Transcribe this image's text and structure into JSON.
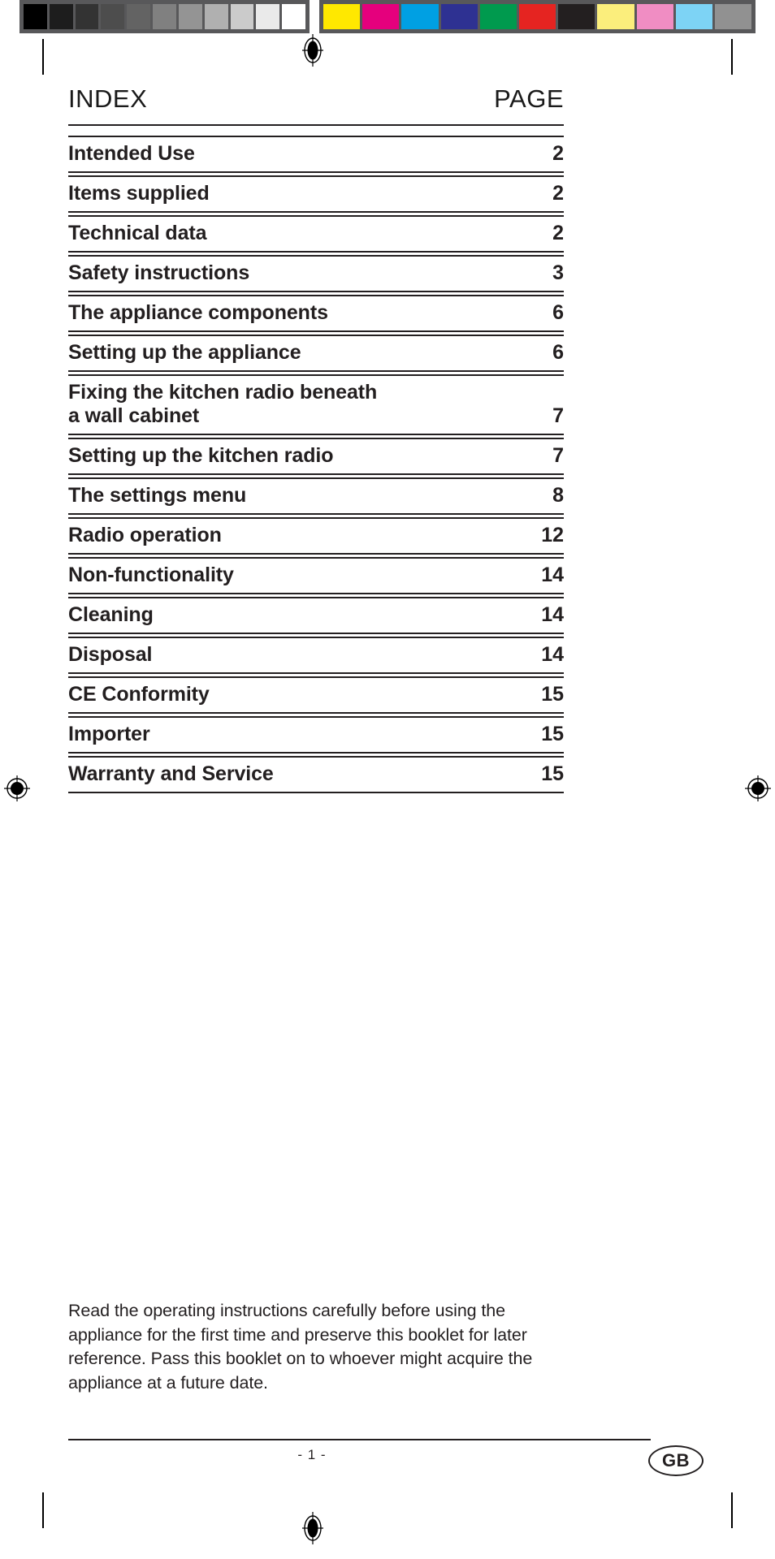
{
  "document": {
    "page_number_footer": "- 1 -",
    "language_badge": "GB"
  },
  "calibration": {
    "gray_bar": {
      "name": "grayscale-calibration-bar",
      "swatches": [
        "#000000",
        "#1d1d1d",
        "#333333",
        "#4d4d4d",
        "#636363",
        "#808080",
        "#949494",
        "#b0b0b0",
        "#cbcbcb",
        "#eaeaea",
        "#ffffff"
      ]
    },
    "color_bar": {
      "name": "color-calibration-bar",
      "swatches": [
        "#ffe800",
        "#e5007d",
        "#00a0e3",
        "#2e3192",
        "#009a4e",
        "#e52421",
        "#231f20",
        "#fbee7c",
        "#f08dc3",
        "#7dd3f5",
        "#919191"
      ]
    }
  },
  "toc": {
    "header": {
      "index_label": "INDEX",
      "page_label": "PAGE"
    },
    "entries": [
      {
        "title": "Intended Use",
        "page": "2"
      },
      {
        "title": "Items supplied",
        "page": "2"
      },
      {
        "title": "Technical data",
        "page": "2"
      },
      {
        "title": "Safety instructions",
        "page": "3"
      },
      {
        "title": "The appliance components",
        "page": "6"
      },
      {
        "title": "Setting up the appliance",
        "page": "6"
      },
      {
        "title": "Fixing the kitchen radio beneath\na wall cabinet",
        "page": "7"
      },
      {
        "title": "Setting up the kitchen radio",
        "page": "7"
      },
      {
        "title": "The settings menu",
        "page": "8"
      },
      {
        "title": "Radio operation",
        "page": "12"
      },
      {
        "title": "Non-functionality",
        "page": "14"
      },
      {
        "title": "Cleaning",
        "page": "14"
      },
      {
        "title": "Disposal",
        "page": "14"
      },
      {
        "title": "CE Conformity",
        "page": "15"
      },
      {
        "title": "Importer",
        "page": "15"
      },
      {
        "title": "Warranty and Service",
        "page": "15"
      }
    ]
  },
  "intro": {
    "text": "Read the operating instructions carefully before using the appliance for the first time and preserve this booklet for later reference. Pass this booklet on to whoever might acquire the appliance at a future date."
  },
  "colors": {
    "ink": "#231f20",
    "paper": "#ffffff",
    "bar_background": "#58585a"
  }
}
